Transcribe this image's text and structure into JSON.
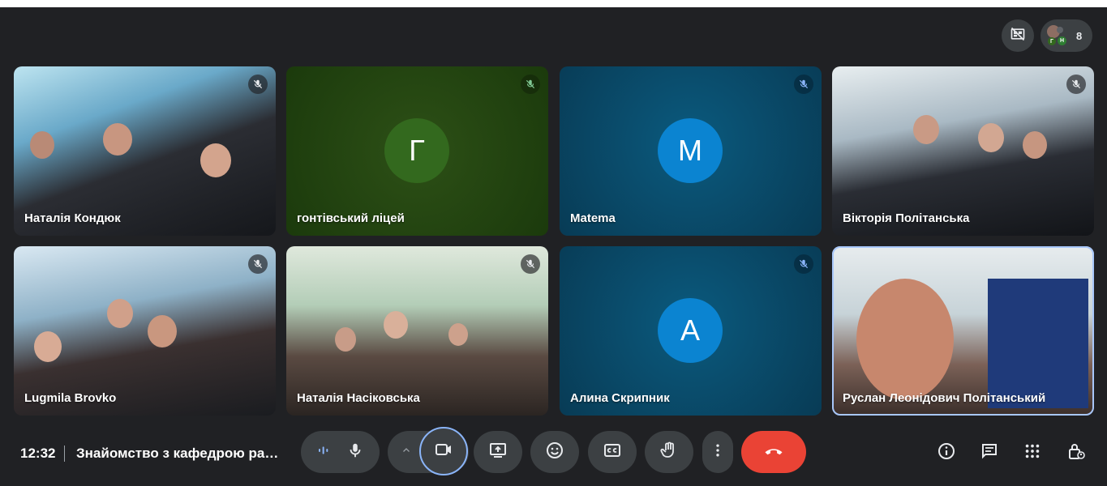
{
  "top": {
    "participant_count": "8",
    "avatar_letters": [
      "Г",
      "Н"
    ]
  },
  "tiles": [
    {
      "name": "Наталія Кондюк",
      "type": "video"
    },
    {
      "name": "гонтівський ліцей",
      "type": "avatar",
      "initial": "Г",
      "avatar_color": "#33691e"
    },
    {
      "name": "Matema",
      "type": "avatar",
      "initial": "M",
      "avatar_color": "#0b84d1"
    },
    {
      "name": "Вікторія Політанська",
      "type": "video"
    },
    {
      "name": "Lugmila Brovko",
      "type": "video"
    },
    {
      "name": "Наталія Насіковська",
      "type": "video"
    },
    {
      "name": "Алина Скрипник",
      "type": "avatar",
      "initial": "A",
      "avatar_color": "#0b84d1"
    },
    {
      "name": "Руслан Леонідович Політанський",
      "type": "video"
    }
  ],
  "bottom": {
    "time": "12:32",
    "meeting_title": "Знайомство з кафедрою радіотехніки"
  },
  "colors": {
    "background": "#202124",
    "control": "#3c4043",
    "hangup": "#ea4335",
    "selected_outline": "#a8c7fa"
  },
  "icons": {
    "layout": "no-layout-icon",
    "mic_off": "mic-off-icon",
    "mic": "mic-icon",
    "camera": "camera-icon",
    "present": "present-screen-icon",
    "emoji": "emoji-icon",
    "captions": "captions-icon",
    "raise_hand": "raise-hand-icon",
    "more": "more-vert-icon",
    "hangup": "call-end-icon",
    "info": "info-icon",
    "chat": "chat-icon",
    "activities": "apps-grid-icon",
    "host_controls": "host-lock-icon"
  }
}
